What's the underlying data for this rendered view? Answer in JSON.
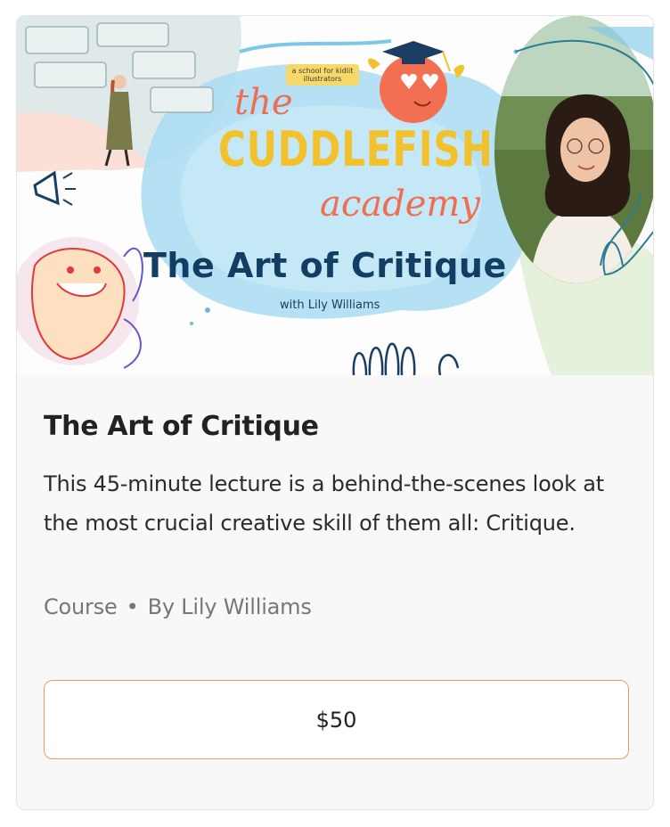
{
  "banner": {
    "tagline": "a school for kidlit illustrators",
    "brand_the": "the",
    "brand_name": "CUDDLEFISH",
    "brand_academy": "academy",
    "course_title": "The Art of Critique",
    "byline": "with Lily Williams",
    "colors": {
      "brand_yellow": "#f2c12e",
      "brand_coral": "#ee6e53",
      "title_navy": "#123e63",
      "splash_blue": "#8fd0ee"
    }
  },
  "product": {
    "title": "The Art of Critique",
    "description": "This 45-minute lecture is a behind-the-scenes look at the most crucial creative skill of them all: Critique.",
    "type": "Course",
    "separator": "•",
    "author": "By Lily Williams",
    "price": "$50"
  },
  "colors": {
    "button_border": "#f09a5e",
    "card_background": "#f8f8f8"
  }
}
